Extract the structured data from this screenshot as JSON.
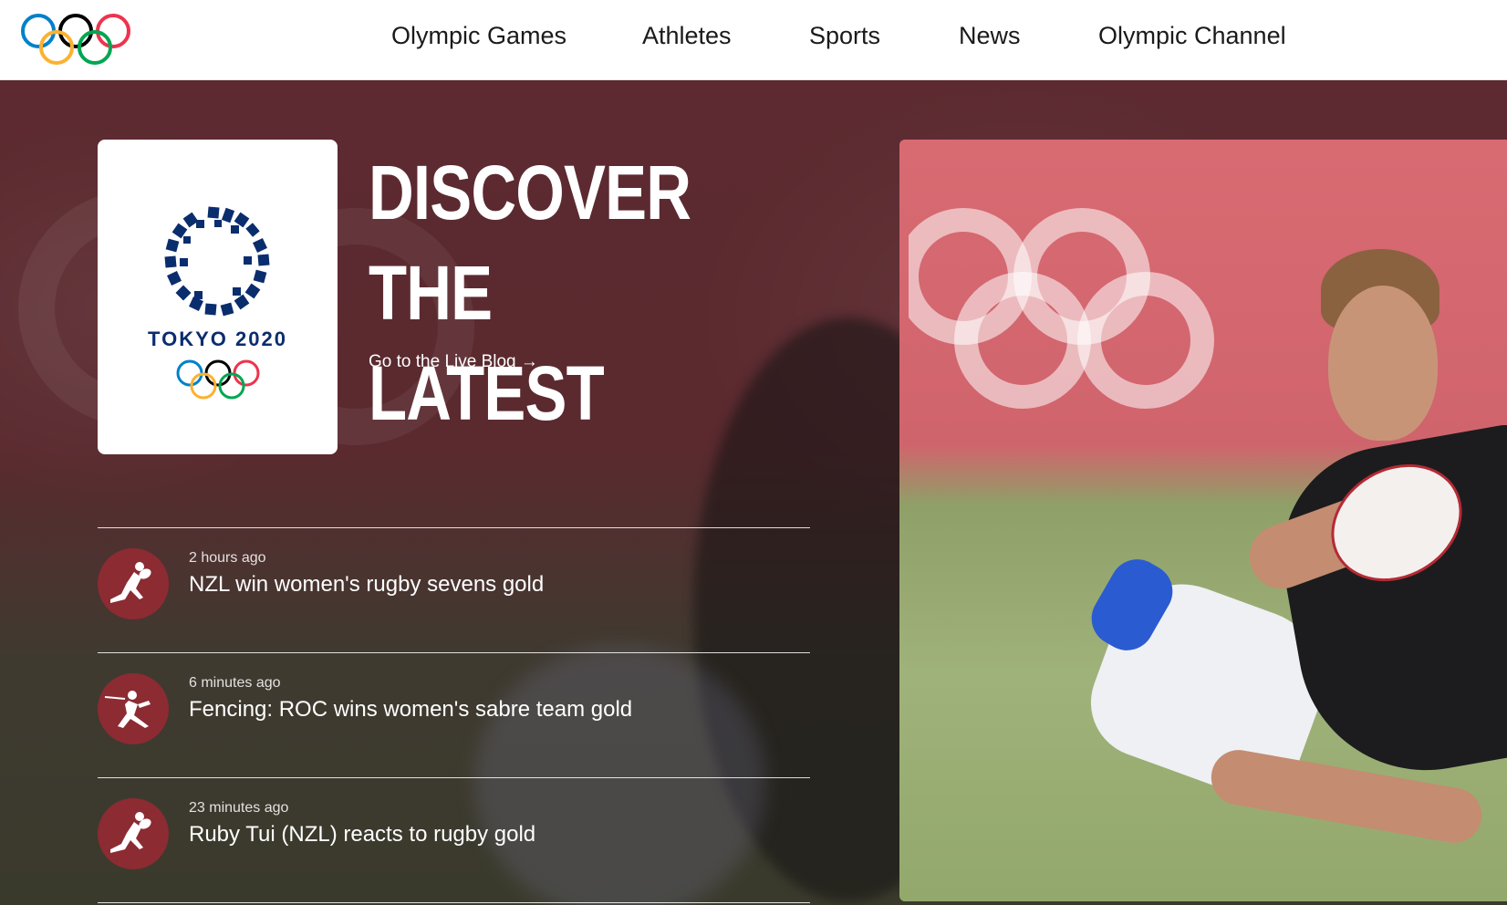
{
  "header": {
    "logo_name": "olympic-rings-logo",
    "nav": [
      {
        "label": "Olympic Games"
      },
      {
        "label": "Athletes"
      },
      {
        "label": "Sports"
      },
      {
        "label": "News"
      },
      {
        "label": "Olympic Channel"
      }
    ]
  },
  "hero": {
    "card_brand": "TOKYO 2020",
    "headline_line1": "DISCOVER THE",
    "headline_line2": "LATEST",
    "live_link": "Go to the Live Blog →",
    "feed": [
      {
        "time": "2 hours ago",
        "title": "NZL win women's rugby sevens gold",
        "icon": "rugby-icon"
      },
      {
        "time": "6 minutes ago",
        "title": "Fencing: ROC wins women's sabre team gold",
        "icon": "fencing-icon"
      },
      {
        "time": "23 minutes ago",
        "title": "Ruby Tui (NZL) reacts to rugby gold",
        "icon": "rugby-icon"
      }
    ]
  },
  "colors": {
    "icon_circle": "#8c2b32",
    "tokyo_blue": "#0a2d6e",
    "ring_blue": "#0081c8",
    "ring_yellow": "#fcb131",
    "ring_black": "#000000",
    "ring_green": "#00a651",
    "ring_red": "#ee334e"
  }
}
